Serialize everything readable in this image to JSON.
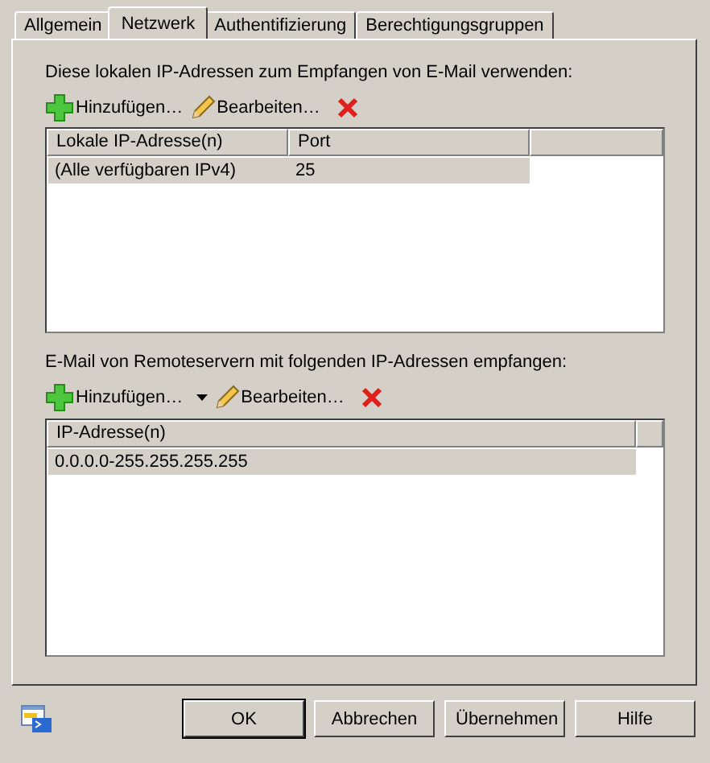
{
  "tabs": [
    {
      "label": "Allgemein",
      "selected": false
    },
    {
      "label": "Netzwerk",
      "selected": true
    },
    {
      "label": "Authentifizierung",
      "selected": false
    },
    {
      "label": "Berechtigungsgruppen",
      "selected": false
    }
  ],
  "sections": [
    {
      "label": "Diese lokalen IP-Adressen zum Empfangen von E-Mail verwenden:",
      "toolbar": [
        {
          "kind": "add",
          "label": "Hinzufügen…"
        },
        {
          "kind": "edit",
          "label": "Bearbeiten…"
        },
        {
          "kind": "delete"
        }
      ],
      "columns": [
        "Lokale IP-Adresse(n)",
        "Port"
      ],
      "rows": [
        {
          "cells": [
            "(Alle verfügbaren IPv4)",
            "25"
          ],
          "selected": true
        }
      ]
    },
    {
      "label": "E-Mail von Remoteservern mit folgenden IP-Adressen empfangen:",
      "toolbar": [
        {
          "kind": "add",
          "label": "Hinzufügen…",
          "dropdown": true
        },
        {
          "kind": "edit",
          "label": "Bearbeiten…"
        },
        {
          "kind": "delete"
        }
      ],
      "columns": [
        "IP-Adresse(n)"
      ],
      "rows": [
        {
          "cells": [
            "0.0.0.0-255.255.255.255"
          ],
          "selected": true
        }
      ]
    }
  ],
  "buttons": [
    {
      "label": "OK",
      "default": true
    },
    {
      "label": "Abbrechen",
      "default": false
    },
    {
      "label": "Übernehmen",
      "default": false
    },
    {
      "label": "Hilfe",
      "default": false
    }
  ]
}
